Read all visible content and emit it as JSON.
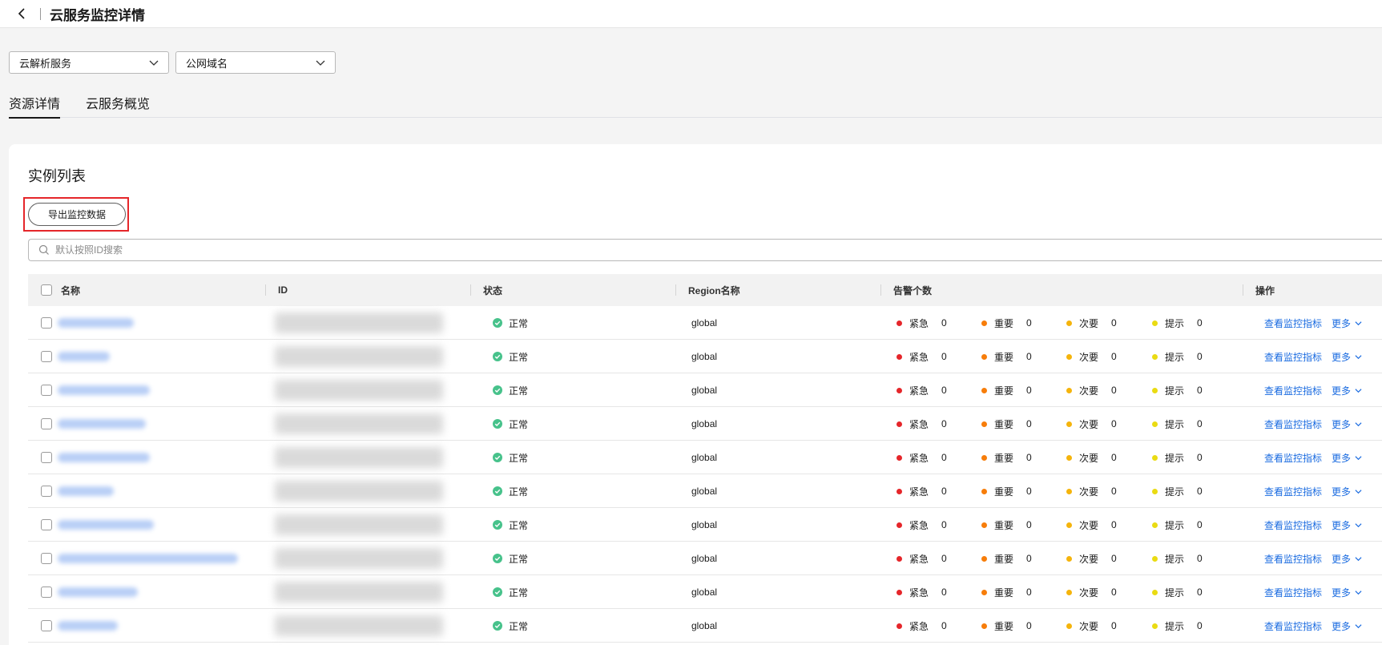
{
  "header": {
    "title": "云服务监控详情"
  },
  "filters": {
    "service": "云解析服务",
    "dimension": "公网域名"
  },
  "tabs": [
    {
      "label": "资源详情"
    },
    {
      "label": "云服务概览"
    }
  ],
  "panel": {
    "title": "实例列表",
    "export_label": "导出监控数据",
    "search_placeholder": "默认按照ID搜索"
  },
  "table": {
    "headers": {
      "name": "名称",
      "id": "ID",
      "status": "状态",
      "region": "Region名称",
      "alarms": "告警个数",
      "actions": "操作"
    },
    "alarm_labels": {
      "critical": "紧急",
      "major": "重要",
      "minor": "次要",
      "info": "提示"
    },
    "action_labels": {
      "view": "查看监控指标",
      "more": "更多"
    },
    "rows": [
      {
        "status": "正常",
        "region": "global",
        "critical": "0",
        "major": "0",
        "minor": "0",
        "info": "0"
      },
      {
        "status": "正常",
        "region": "global",
        "critical": "0",
        "major": "0",
        "minor": "0",
        "info": "0"
      },
      {
        "status": "正常",
        "region": "global",
        "critical": "0",
        "major": "0",
        "minor": "0",
        "info": "0"
      },
      {
        "status": "正常",
        "region": "global",
        "critical": "0",
        "major": "0",
        "minor": "0",
        "info": "0"
      },
      {
        "status": "正常",
        "region": "global",
        "critical": "0",
        "major": "0",
        "minor": "0",
        "info": "0"
      },
      {
        "status": "正常",
        "region": "global",
        "critical": "0",
        "major": "0",
        "minor": "0",
        "info": "0"
      },
      {
        "status": "正常",
        "region": "global",
        "critical": "0",
        "major": "0",
        "minor": "0",
        "info": "0"
      },
      {
        "status": "正常",
        "region": "global",
        "critical": "0",
        "major": "0",
        "minor": "0",
        "info": "0"
      },
      {
        "status": "正常",
        "region": "global",
        "critical": "0",
        "major": "0",
        "minor": "0",
        "info": "0"
      },
      {
        "status": "正常",
        "region": "global",
        "critical": "0",
        "major": "0",
        "minor": "0",
        "info": "0"
      }
    ]
  },
  "colors": {
    "critical": "#e5262a",
    "major": "#f77d0a",
    "minor": "#f5b40c",
    "info": "#eadb12",
    "status_ok": "#47c28b",
    "link": "#1a6be0",
    "highlight": "#e5262a"
  },
  "icons": {
    "back": "chevron-left-icon",
    "dropdown": "chevron-down-icon",
    "search": "search-icon",
    "status": "check-circle-icon"
  }
}
